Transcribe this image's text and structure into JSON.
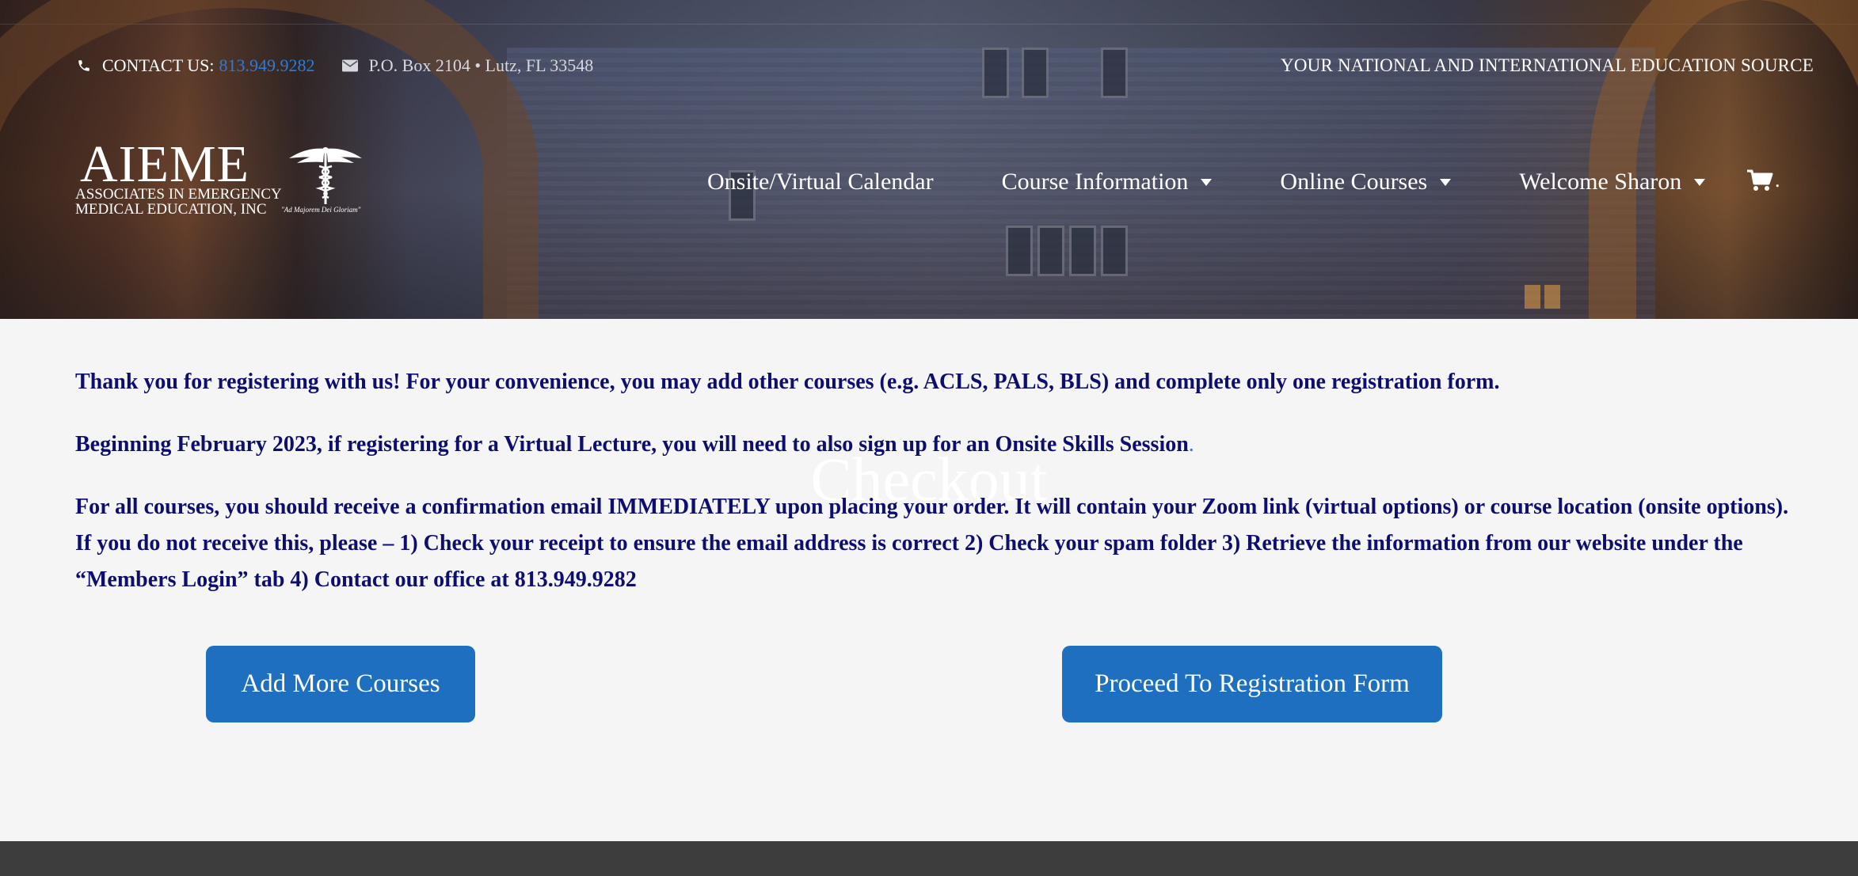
{
  "topbar": {
    "contact_label": "CONTACT US:",
    "phone": "813.949.9282",
    "address": "P.O. Box 2104 • Lutz, FL 33548",
    "tagline": "YOUR NATIONAL AND INTERNATIONAL EDUCATION SOURCE",
    "icons": [
      "phone-icon",
      "mail-icon"
    ]
  },
  "logo": {
    "acronym": "AIEME",
    "line1": "ASSOCIATES IN EMERGENCY",
    "line2": "MEDICAL EDUCATION, INC",
    "motto": "\"Ad Majorem Dei Gloriam\""
  },
  "nav": {
    "items": [
      {
        "label": "Onsite/Virtual Calendar",
        "has_dropdown": false
      },
      {
        "label": "Course Information",
        "has_dropdown": true
      },
      {
        "label": "Online Courses",
        "has_dropdown": true
      },
      {
        "label": "Welcome Sharon",
        "has_dropdown": true
      }
    ],
    "cart_suffix": "."
  },
  "hero": {
    "page_title": "Checkout"
  },
  "content": {
    "paragraph1": "Thank you for registering with us! For your convenience, you may add other courses (e.g. ACLS, PALS, BLS) and complete only one registration form.",
    "paragraph2": "Beginning February 2023, if registering for a Virtual Lecture, you will need to also sign up for an Onsite Skills Session",
    "paragraph2_end": ".",
    "paragraph3": "For all courses, you should receive a confirmation email IMMEDIATELY upon placing your order. It will contain your Zoom link (virtual options) or course location (onsite options). If you do not receive this, please – 1) Check your receipt to ensure the email address is correct 2) Check your spam folder 3) Retrieve the information from our website under the “Members Login” tab 4) Contact our office at 813.949.9282"
  },
  "buttons": {
    "add_more": "Add More Courses",
    "proceed": "Proceed To Registration Form"
  },
  "colors": {
    "accent_blue": "#1e6fc0",
    "link_blue": "#2f7bd3",
    "text_navy": "#0e0e6e",
    "page_bg": "#f5f5f5",
    "footer": "#3d3d3d"
  }
}
